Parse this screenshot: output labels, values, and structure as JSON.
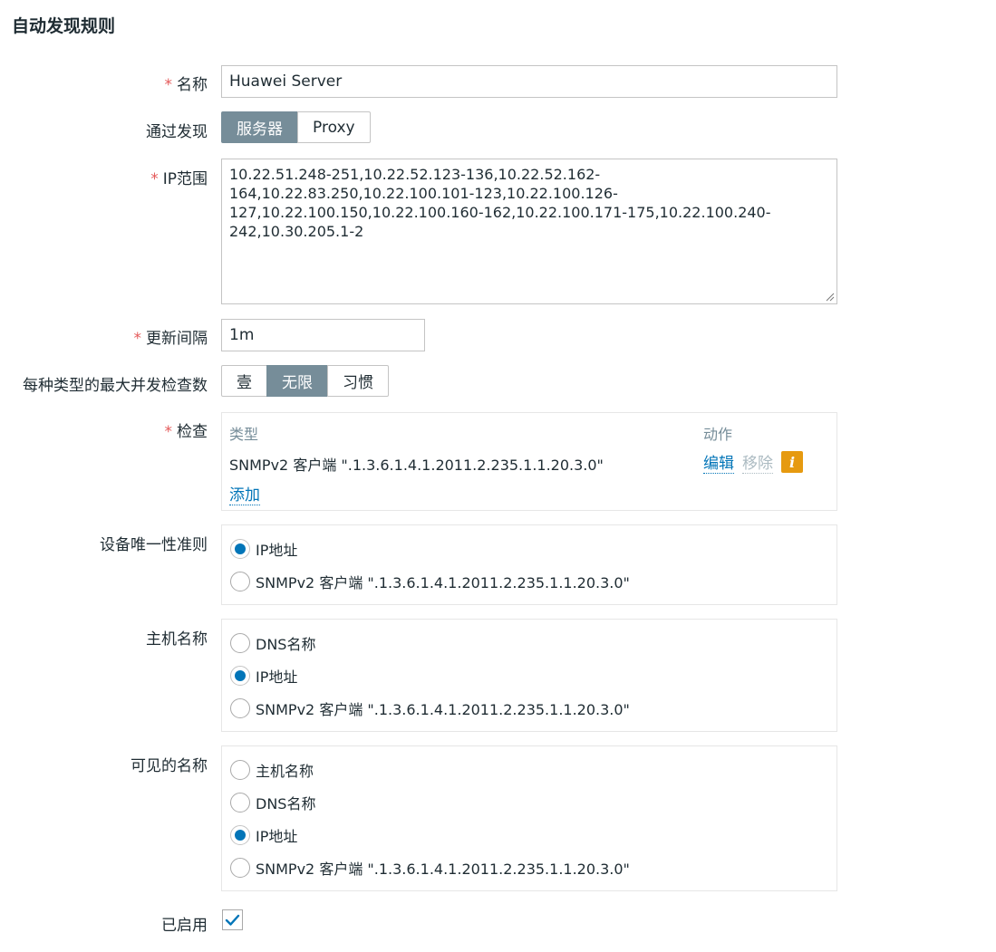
{
  "page": {
    "title": "自动发现规则"
  },
  "form": {
    "name": {
      "label": "名称",
      "value": "Huawei Server"
    },
    "discovery_by": {
      "label": "通过发现",
      "options": [
        "服务器",
        "Proxy"
      ],
      "selected": "服务器"
    },
    "ip_range": {
      "label": "IP范围",
      "lines": [
        "10.22.51.248-251,10.22.52.123-136,10.22.52.162-",
        "164,10.22.83.250,10.22.100.101-123,10.22.100.126-",
        "127,10.22.100.150,10.22.100.160-162,10.22.100.171-175,10.22.100.240-",
        "242,10.30.205.1-2"
      ]
    },
    "update_interval": {
      "label": "更新间隔",
      "value": "1m"
    },
    "max_concurrent": {
      "label": "每种类型的最大并发检查数",
      "options": [
        "壹",
        "无限",
        "习惯"
      ],
      "selected": "无限"
    },
    "checks": {
      "label": "检查",
      "col_type": "类型",
      "col_action": "动作",
      "rows": [
        {
          "type": "SNMPv2 客户端 \".1.3.6.1.4.1.2011.2.235.1.1.20.3.0\"",
          "edit": "编辑",
          "remove": "移除",
          "info": "i"
        }
      ],
      "add": "添加"
    },
    "uniqueness": {
      "label": "设备唯一性准则",
      "options": [
        "IP地址",
        "SNMPv2 客户端 \".1.3.6.1.4.1.2011.2.235.1.1.20.3.0\""
      ],
      "selected_index": 0
    },
    "host_name": {
      "label": "主机名称",
      "options": [
        "DNS名称",
        "IP地址",
        "SNMPv2 客户端 \".1.3.6.1.4.1.2011.2.235.1.1.20.3.0\""
      ],
      "selected_index": 1
    },
    "visible_name": {
      "label": "可见的名称",
      "options": [
        "主机名称",
        "DNS名称",
        "IP地址",
        "SNMPv2 客户端 \".1.3.6.1.4.1.2011.2.235.1.1.20.3.0\""
      ],
      "selected_index": 2
    },
    "enabled": {
      "label": "已启用",
      "checked": true
    }
  },
  "required_marker": "*",
  "colors": {
    "accent": "#0275b8",
    "segment_active": "#768d99",
    "required": "#e45959",
    "info": "#e69a10"
  }
}
